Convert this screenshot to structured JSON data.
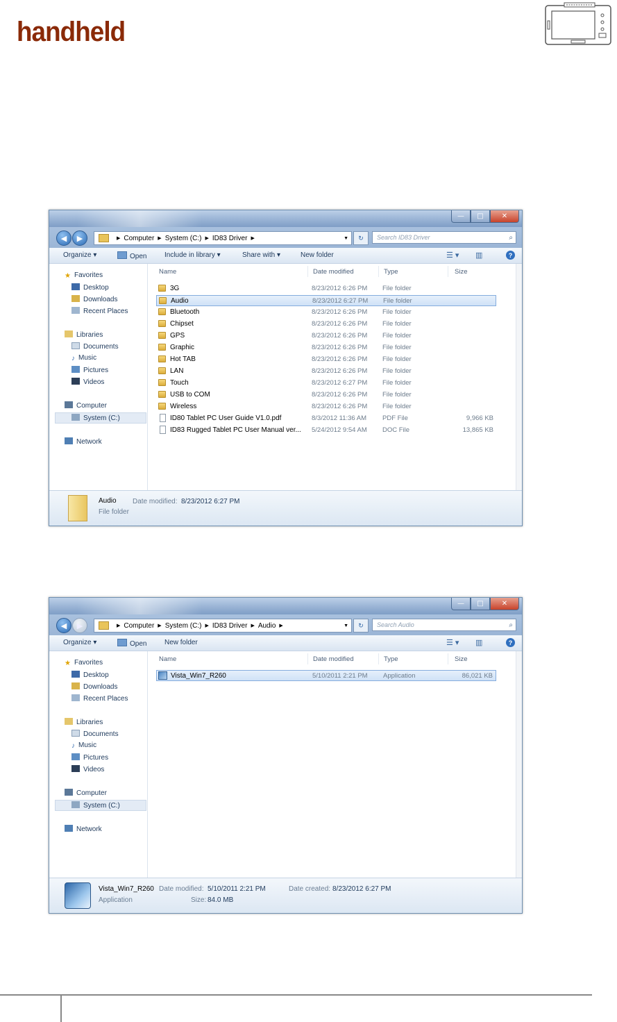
{
  "brand": {
    "logo_text": "handheld"
  },
  "window1": {
    "address": [
      "Computer",
      "System (C:)",
      "ID83 Driver"
    ],
    "search_placeholder": "Search ID83 Driver",
    "toolbar": {
      "organize": "Organize ▾",
      "open": "Open",
      "include": "Include in library ▾",
      "share": "Share with ▾",
      "new_folder": "New folder"
    },
    "columns": {
      "name": "Name",
      "date": "Date modified",
      "type": "Type",
      "size": "Size"
    },
    "rows": [
      {
        "name": "3G",
        "date": "8/23/2012 6:26 PM",
        "type": "File folder",
        "size": "",
        "icon": "folder-icon"
      },
      {
        "name": "Audio",
        "date": "8/23/2012 6:27 PM",
        "type": "File folder",
        "size": "",
        "icon": "folder-icon",
        "selected": true
      },
      {
        "name": "Bluetooth",
        "date": "8/23/2012 6:26 PM",
        "type": "File folder",
        "size": "",
        "icon": "folder-icon"
      },
      {
        "name": "Chipset",
        "date": "8/23/2012 6:26 PM",
        "type": "File folder",
        "size": "",
        "icon": "folder-icon"
      },
      {
        "name": "GPS",
        "date": "8/23/2012 6:26 PM",
        "type": "File folder",
        "size": "",
        "icon": "folder-icon"
      },
      {
        "name": "Graphic",
        "date": "8/23/2012 6:26 PM",
        "type": "File folder",
        "size": "",
        "icon": "folder-icon"
      },
      {
        "name": "Hot TAB",
        "date": "8/23/2012 6:26 PM",
        "type": "File folder",
        "size": "",
        "icon": "folder-icon"
      },
      {
        "name": "LAN",
        "date": "8/23/2012 6:26 PM",
        "type": "File folder",
        "size": "",
        "icon": "folder-icon"
      },
      {
        "name": "Touch",
        "date": "8/23/2012 6:27 PM",
        "type": "File folder",
        "size": "",
        "icon": "folder-icon"
      },
      {
        "name": "USB to COM",
        "date": "8/23/2012 6:26 PM",
        "type": "File folder",
        "size": "",
        "icon": "folder-icon"
      },
      {
        "name": "Wireless",
        "date": "8/23/2012 6:26 PM",
        "type": "File folder",
        "size": "",
        "icon": "folder-icon"
      },
      {
        "name": "ID80 Tablet PC User Guide V1.0.pdf",
        "date": "8/3/2012 11:36 AM",
        "type": "PDF File",
        "size": "9,966 KB",
        "icon": "document-icon"
      },
      {
        "name": "ID83 Rugged Tablet PC  User Manual ver...",
        "date": "5/24/2012 9:54 AM",
        "type": "DOC File",
        "size": "13,865 KB",
        "icon": "document-icon"
      }
    ],
    "details": {
      "name": "Audio",
      "kind": "File folder",
      "modified_label": "Date modified:",
      "modified": "8/23/2012 6:27 PM"
    }
  },
  "window2": {
    "address": [
      "Computer",
      "System (C:)",
      "ID83 Driver",
      "Audio"
    ],
    "search_placeholder": "Search Audio",
    "toolbar": {
      "organize": "Organize ▾",
      "open": "Open",
      "new_folder": "New folder"
    },
    "columns": {
      "name": "Name",
      "date": "Date modified",
      "type": "Type",
      "size": "Size"
    },
    "rows": [
      {
        "name": "Vista_Win7_R260",
        "date": "5/10/2011 2:21 PM",
        "type": "Application",
        "size": "86,021 KB",
        "icon": "application-icon",
        "selected": true
      }
    ],
    "details": {
      "name": "Vista_Win7_R260",
      "kind": "Application",
      "modified_label": "Date modified:",
      "modified": "5/10/2011 2:21 PM",
      "created_label": "Date created:",
      "created": "8/23/2012 6:27 PM",
      "size_label": "Size:",
      "size": "84.0 MB"
    }
  },
  "nav": {
    "favorites": "Favorites",
    "desktop": "Desktop",
    "downloads": "Downloads",
    "recent": "Recent Places",
    "libraries": "Libraries",
    "documents": "Documents",
    "music": "Music",
    "pictures": "Pictures",
    "videos": "Videos",
    "computer": "Computer",
    "system": "System (C:)",
    "network": "Network"
  },
  "window_controls": {
    "minimize": "—",
    "maximize": "□",
    "close": "✕"
  },
  "colors": {
    "logo": "#8a2a08",
    "selection": "#cfe2f7",
    "folder": "#e9c45a"
  }
}
